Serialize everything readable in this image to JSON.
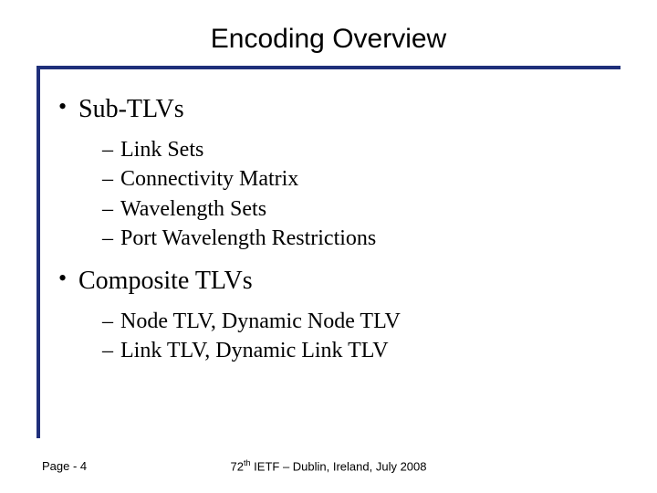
{
  "title": "Encoding Overview",
  "bullets": [
    {
      "label": "Sub-TLVs",
      "sub": [
        "Link Sets",
        "Connectivity Matrix",
        "Wavelength Sets",
        "Port Wavelength Restrictions"
      ]
    },
    {
      "label": "Composite TLVs",
      "sub": [
        "Node TLV, Dynamic Node TLV",
        "Link TLV, Dynamic Link TLV"
      ]
    }
  ],
  "footer": {
    "page_label": "Page - 4",
    "ord": "72",
    "ord_suffix": "th",
    "rest": " IETF – Dublin, Ireland, July 2008"
  }
}
